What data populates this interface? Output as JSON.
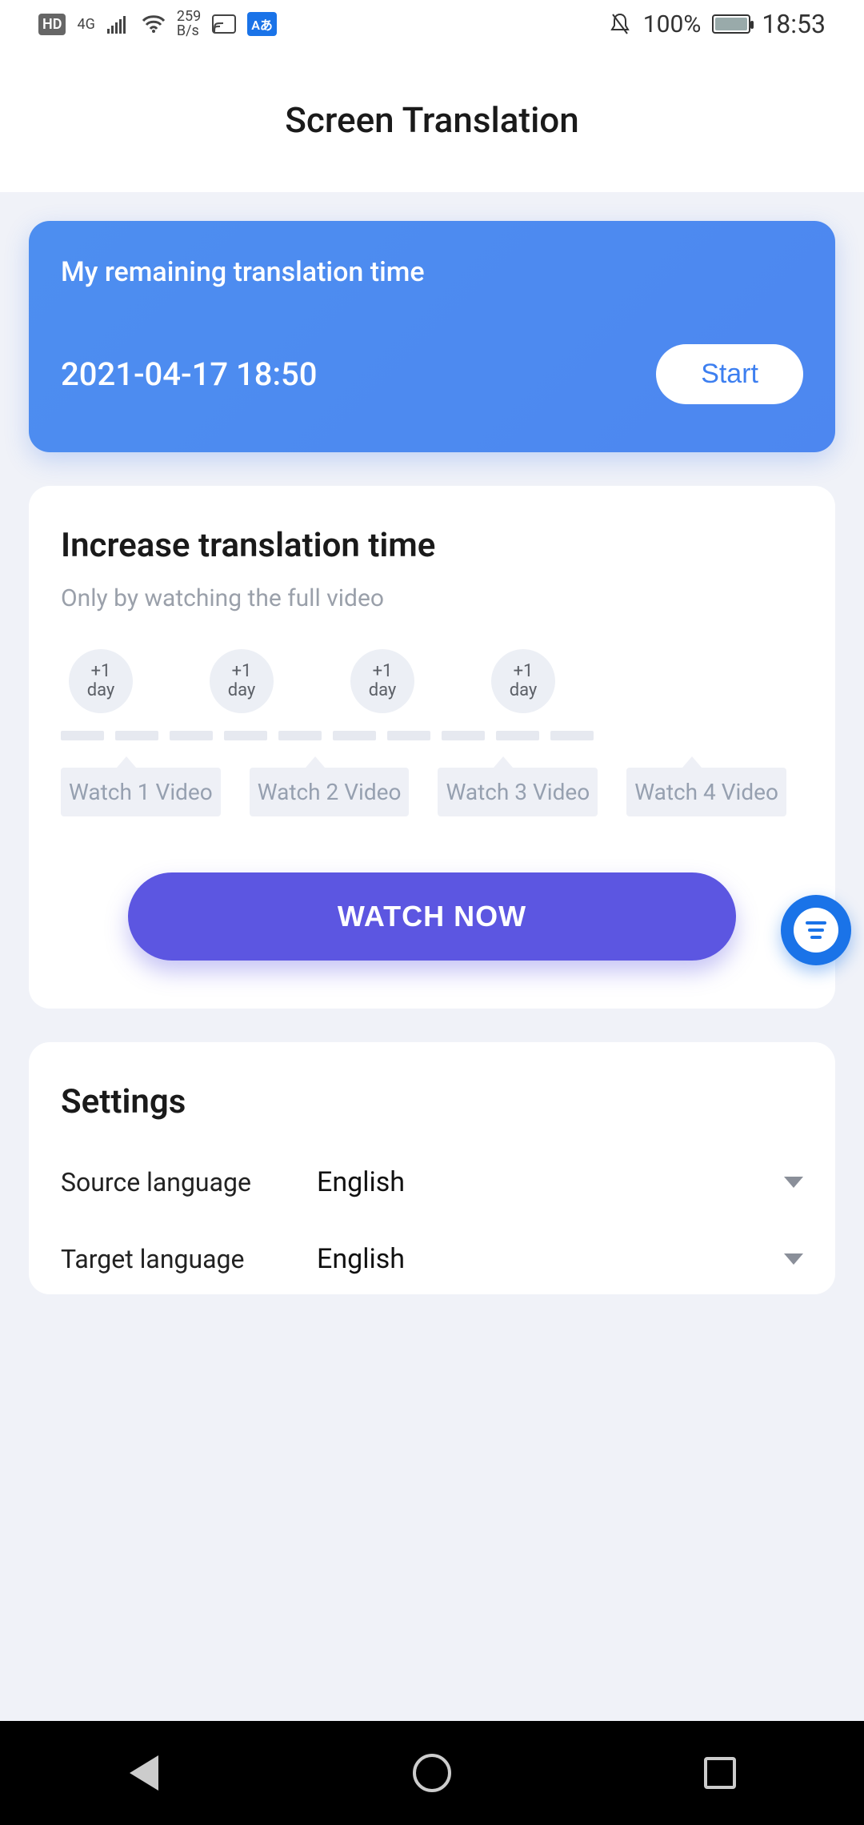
{
  "status": {
    "hd": "HD",
    "network": "4G",
    "speed_top": "259",
    "speed_bot": "B/s",
    "translate_badge": "Aあ",
    "battery_percent": "100%",
    "time": "18:53"
  },
  "header": {
    "title": "Screen Translation"
  },
  "remaining": {
    "label": "My remaining translation time",
    "timestamp": "2021-04-17 18:50",
    "start_label": "Start"
  },
  "increase": {
    "title": "Increase translation time",
    "subtitle": "Only by watching the full video",
    "chips": [
      {
        "top": "+1",
        "bot": "day"
      },
      {
        "top": "+1",
        "bot": "day"
      },
      {
        "top": "+1",
        "bot": "day"
      },
      {
        "top": "+1",
        "bot": "day"
      }
    ],
    "watch_items": [
      "Watch 1 Video",
      "Watch 2 Video",
      "Watch 3 Video",
      "Watch 4 Video"
    ],
    "watch_now_label": "WATCH NOW"
  },
  "settings": {
    "title": "Settings",
    "source_label": "Source language",
    "source_value": "English",
    "target_label": "Target language",
    "target_value": "English"
  }
}
